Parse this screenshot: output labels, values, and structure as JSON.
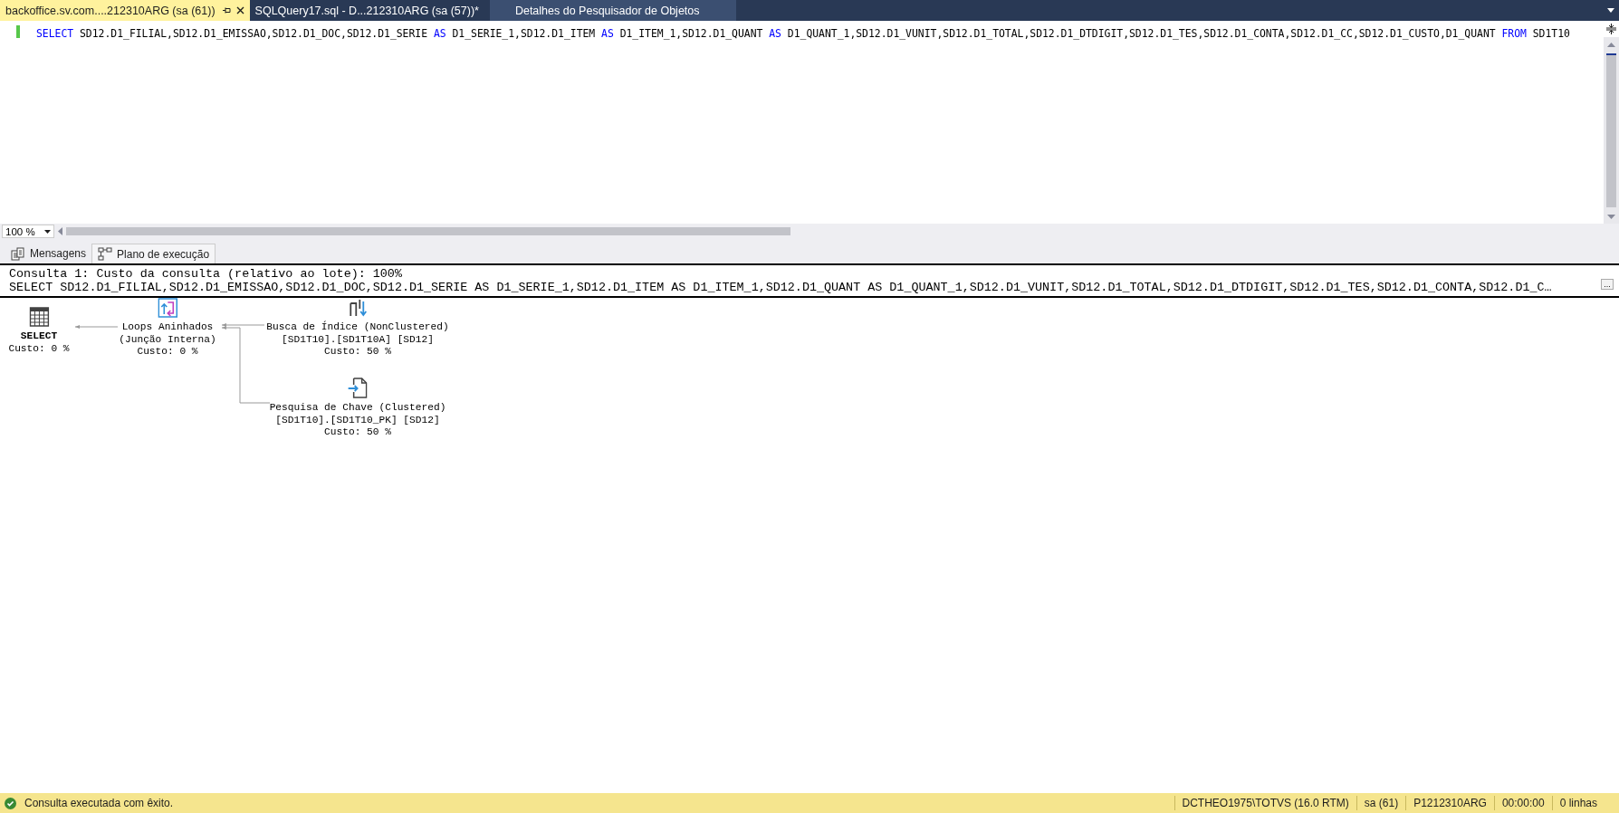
{
  "document_tabs": [
    {
      "label": "backoffice.sv.com....212310ARG (sa (61))",
      "selected": true,
      "pinned": true
    },
    {
      "label": "SQLQuery17.sql - D...212310ARG (sa (57))*",
      "selected": false,
      "pinned": false
    },
    {
      "label": "Detalhes do Pesquisador de Objetos",
      "selected": false,
      "pinned": false
    }
  ],
  "editor": {
    "code": [
      {
        "kind": "keyword",
        "text": "SELECT"
      },
      {
        "kind": "plain",
        "text": " SD12.D1_FILIAL,SD12.D1_EMISSAO,SD12.D1_DOC,SD12.D1_SERIE "
      },
      {
        "kind": "keyword",
        "text": "AS"
      },
      {
        "kind": "plain",
        "text": " D1_SERIE_1,SD12.D1_ITEM "
      },
      {
        "kind": "keyword",
        "text": "AS"
      },
      {
        "kind": "plain",
        "text": " D1_ITEM_1,SD12.D1_QUANT "
      },
      {
        "kind": "keyword",
        "text": "AS"
      },
      {
        "kind": "plain",
        "text": " D1_QUANT_1,SD12.D1_VUNIT,SD12.D1_TOTAL,SD12.D1_DTDIGIT,SD12.D1_TES,SD12.D1_CONTA,SD12.D1_CC,SD12.D1_CUSTO,D1_QUANT "
      },
      {
        "kind": "keyword",
        "text": "FROM"
      },
      {
        "kind": "plain",
        "text": " SD1T10"
      }
    ],
    "zoom": "100 %"
  },
  "result_tabs": [
    {
      "label": "Mensagens",
      "kind": "messages",
      "selected": false
    },
    {
      "label": "Plano de execução",
      "kind": "plan",
      "selected": true
    }
  ],
  "plan": {
    "header": "Consulta 1: Custo da consulta (relativo ao lote): 100%",
    "query": "SELECT SD12.D1_FILIAL,SD12.D1_EMISSAO,SD12.D1_DOC,SD12.D1_SERIE AS D1_SERIE_1,SD12.D1_ITEM AS D1_ITEM_1,SD12.D1_QUANT AS D1_QUANT_1,SD12.D1_VUNIT,SD12.D1_TOTAL,SD12.D1_DTDIGIT,SD12.D1_TES,SD12.D1_CONTA,SD12.D1_C…",
    "more_button": "...",
    "nodes": [
      {
        "kind": "select",
        "lines": [
          "SELECT",
          "Custo: 0 %"
        ]
      },
      {
        "kind": "nested_loops",
        "lines": [
          "Loops Aninhados",
          "(Junção Interna)",
          "Custo: 0 %"
        ]
      },
      {
        "kind": "index_seek",
        "lines": [
          "Busca de Índice (NonClustered)",
          "[SD1T10].[SD1T10A] [SD12]",
          "Custo: 50 %"
        ]
      },
      {
        "kind": "key_lookup",
        "lines": [
          "Pesquisa de Chave (Clustered)",
          "[SD1T10].[SD1T10_PK] [SD12]",
          "Custo: 50 %"
        ]
      }
    ]
  },
  "status_bar": {
    "message": "Consulta executada com êxito.",
    "sections": [
      "DCTHEO1975\\TOTVS (16.0 RTM)",
      "sa (61)",
      "P1212310ARG",
      "00:00:00",
      "0 linhas"
    ]
  }
}
